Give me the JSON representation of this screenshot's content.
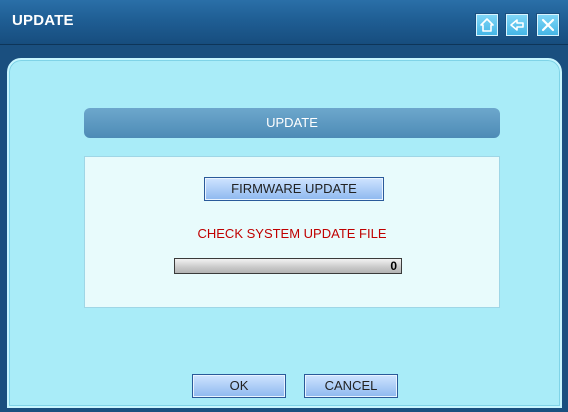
{
  "window": {
    "title": "UPDATE",
    "controls": {
      "home_icon": "home-icon",
      "back_icon": "arrow-left-icon",
      "close_icon": "close-icon"
    }
  },
  "section": {
    "header": "UPDATE"
  },
  "update_panel": {
    "firmware_button": "FIRMWARE UPDATE",
    "status_message": "CHECK SYSTEM UPDATE FILE",
    "progress_value": "0"
  },
  "footer": {
    "ok_label": "OK",
    "cancel_label": "CANCEL"
  },
  "colors": {
    "titlebar": "#1f5e94",
    "content_background": "#a9ecf8",
    "status_text": "#c00000",
    "button": "#8db8ef"
  }
}
